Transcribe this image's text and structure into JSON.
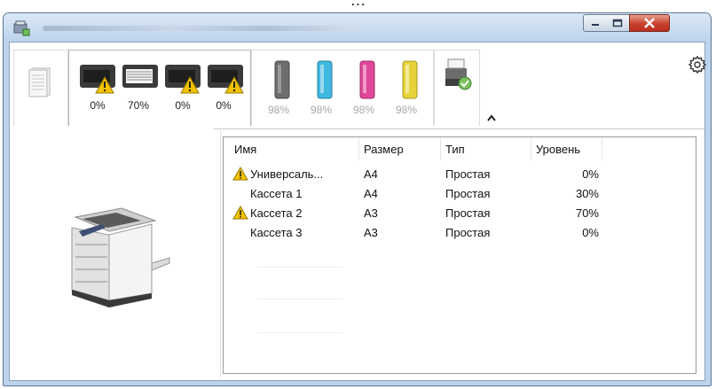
{
  "top_caption": "…",
  "window": {
    "title": ""
  },
  "toolbar": {
    "trays": [
      {
        "name": "paper-tray-1",
        "level": "0%",
        "warning": true
      },
      {
        "name": "paper-tray-2",
        "level": "70%",
        "warning": false
      },
      {
        "name": "paper-tray-3",
        "level": "0%",
        "warning": true
      },
      {
        "name": "paper-tray-4",
        "level": "0%",
        "warning": true
      }
    ],
    "toners": [
      {
        "name": "toner-black",
        "level": "98%",
        "color": "#6d6d6d"
      },
      {
        "name": "toner-cyan",
        "level": "98%",
        "color": "#3fb8e0"
      },
      {
        "name": "toner-magenta",
        "level": "98%",
        "color": "#e0479a"
      },
      {
        "name": "toner-yellow",
        "level": "98%",
        "color": "#e6d33b"
      }
    ],
    "status_icon": "printer-ok-icon",
    "settings_icon": "gear-icon",
    "collapse_icon": "chevron-up-icon"
  },
  "table": {
    "headers": [
      "Имя",
      "Размер",
      "Тип",
      "Уровень"
    ],
    "rows": [
      {
        "name": "Универсаль...",
        "size": "A4",
        "type": "Простая",
        "level": "0%",
        "warning": true
      },
      {
        "name": "Кассета 1",
        "size": "A4",
        "type": "Простая",
        "level": "30%",
        "warning": false
      },
      {
        "name": "Кассета 2",
        "size": "A3",
        "type": "Простая",
        "level": "70%",
        "warning": true
      },
      {
        "name": "Кассета 3",
        "size": "A3",
        "type": "Простая",
        "level": "0%",
        "warning": false
      }
    ]
  },
  "colors": {
    "warning": "#f2c200",
    "title_bar": "#bcd3ec",
    "close_button": "#c8412e"
  }
}
